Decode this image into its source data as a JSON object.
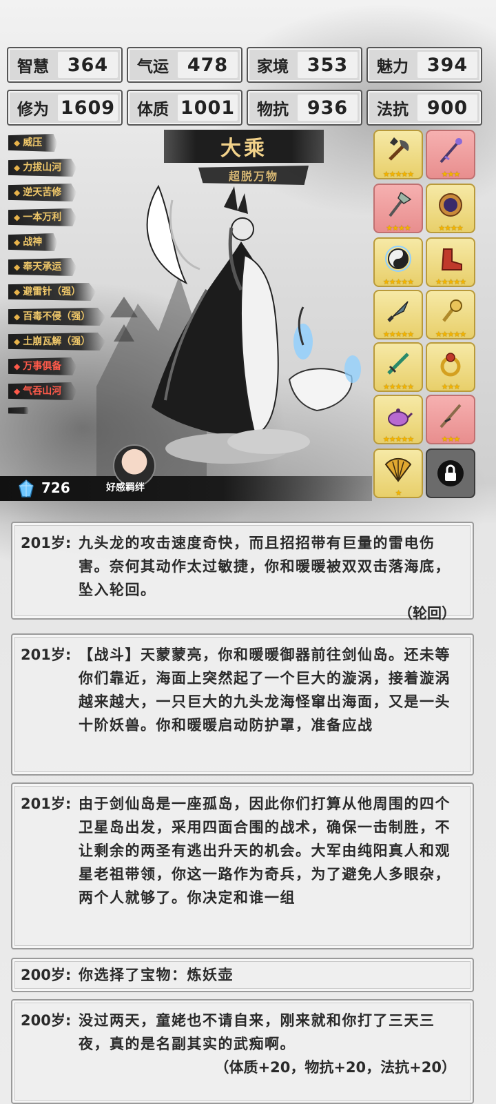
{
  "stats": [
    {
      "label": "智慧",
      "value": "364"
    },
    {
      "label": "气运",
      "value": "478"
    },
    {
      "label": "家境",
      "value": "353"
    },
    {
      "label": "魅力",
      "value": "394"
    },
    {
      "label": "修为",
      "value": "1609"
    },
    {
      "label": "体质",
      "value": "1001"
    },
    {
      "label": "物抗",
      "value": "936"
    },
    {
      "label": "法抗",
      "value": "900"
    }
  ],
  "traits": [
    {
      "name": "威压",
      "color": "#f0c86a"
    },
    {
      "name": "力拔山河",
      "color": "#f0c86a"
    },
    {
      "name": "逆天苦修",
      "color": "#f0c86a"
    },
    {
      "name": "一本万利",
      "color": "#f0c86a"
    },
    {
      "name": "战神",
      "color": "#f0c86a"
    },
    {
      "name": "奉天承运",
      "color": "#f0c86a"
    },
    {
      "name": "避雷针（强）",
      "color": "#f0c86a"
    },
    {
      "name": "百毒不侵（强）",
      "color": "#f0c86a"
    },
    {
      "name": "土崩瓦解（强）",
      "color": "#f0c86a"
    },
    {
      "name": "万事俱备",
      "color": "#ff5a4a"
    },
    {
      "name": "气吞山河",
      "color": "#ff5a4a"
    }
  ],
  "realm": {
    "title": "大乘",
    "subtitle": "超脱万物"
  },
  "equipment": [
    {
      "icon": "axe-icon",
      "stars": 5,
      "rarity": "gold"
    },
    {
      "icon": "staff-icon",
      "stars": 3,
      "rarity": "red"
    },
    {
      "icon": "halberd-icon",
      "stars": 4,
      "rarity": "red"
    },
    {
      "icon": "mirror-icon",
      "stars": 4,
      "rarity": "gold"
    },
    {
      "icon": "orb-icon",
      "stars": 5,
      "rarity": "gold"
    },
    {
      "icon": "boots-icon",
      "stars": 5,
      "rarity": "gold"
    },
    {
      "icon": "dagger-icon",
      "stars": 5,
      "rarity": "gold"
    },
    {
      "icon": "scepter-icon",
      "stars": 5,
      "rarity": "gold"
    },
    {
      "icon": "sword-icon",
      "stars": 5,
      "rarity": "gold"
    },
    {
      "icon": "ring-icon",
      "stars": 3,
      "rarity": "gold"
    },
    {
      "icon": "teapot-icon",
      "stars": 5,
      "rarity": "gold"
    },
    {
      "icon": "blade-icon",
      "stars": 3,
      "rarity": "red"
    },
    {
      "icon": "fan-icon",
      "stars": 1,
      "rarity": "gold"
    }
  ],
  "hud": {
    "gems": "726",
    "bond_label": "好感羁绊"
  },
  "log": [
    {
      "age": "201岁:",
      "text": "九头龙的攻击速度奇快，而且招招带有巨量的雷电伤害。奈何其动作太过敏捷，你和暖暖被双双击落海底，坠入轮回。",
      "footer": "（轮回）"
    },
    {
      "age": "201岁:",
      "text": "【战斗】天蒙蒙亮，你和暖暖御器前往剑仙岛。还未等你们靠近，海面上突然起了一个巨大的漩涡，接着漩涡越来越大，一只巨大的九头龙海怪窜出海面，又是一头十阶妖兽。你和暖暖启动防护罩，准备应战",
      "footer": ""
    },
    {
      "age": "201岁:",
      "text": "由于剑仙岛是一座孤岛，因此你们打算从他周围的四个卫星岛出发，采用四面合围的战术，确保一击制胜，不让剩余的两圣有逃出升天的机会。大军由纯阳真人和观星老祖带领，你这一路作为奇兵，为了避免人多眼杂，两个人就够了。你决定和谁一组",
      "footer": ""
    },
    {
      "age": "200岁:",
      "text": "你选择了宝物：炼妖壶",
      "footer": ""
    },
    {
      "age": "200岁:",
      "text": "没过两天，童姥也不请自来，刚来就和你打了三天三夜，真的是名副其实的武痴啊。",
      "footer": "（体质+20，物抗+20，法抗+20）"
    }
  ]
}
